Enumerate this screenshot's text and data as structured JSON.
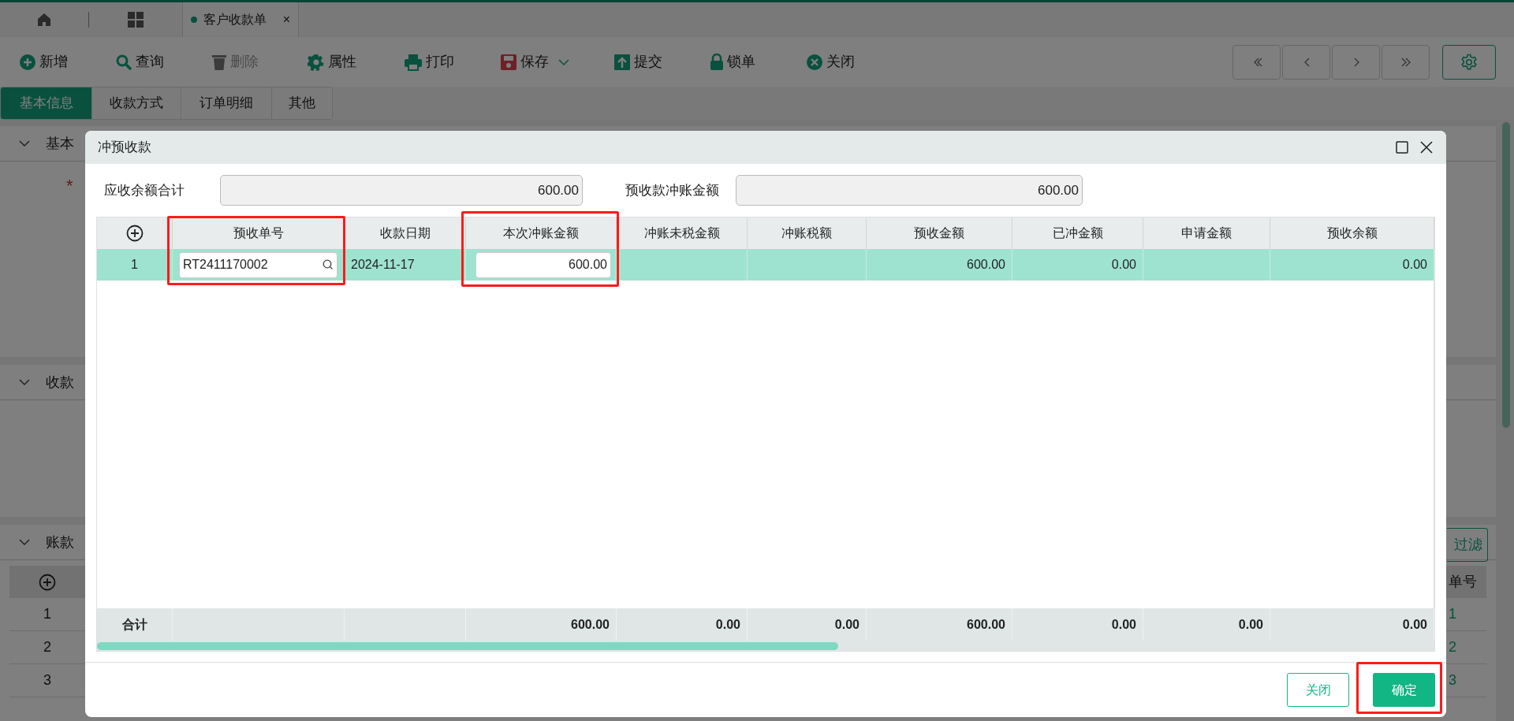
{
  "tab_bar": {
    "tabs": [
      {
        "label": "客户收款单",
        "selected": true,
        "close": "×"
      }
    ]
  },
  "toolbar": {
    "buttons": [
      {
        "label": "新增",
        "kind": "button",
        "disabled": false
      },
      {
        "label": "查询",
        "kind": "button",
        "disabled": false
      },
      {
        "label": "删除",
        "kind": "button",
        "disabled": true
      },
      {
        "label": "属性",
        "kind": "button",
        "disabled": false
      },
      {
        "label": "打印",
        "kind": "button",
        "disabled": false
      },
      {
        "label": "保存",
        "kind": "dropdown",
        "disabled": false
      },
      {
        "label": "提交",
        "kind": "button",
        "disabled": false
      },
      {
        "label": "锁单",
        "kind": "button",
        "disabled": false
      },
      {
        "label": "关闭",
        "kind": "button",
        "disabled": false
      }
    ]
  },
  "page_tabs": [
    {
      "label": "基本信息",
      "selected": true
    },
    {
      "label": "收款方式",
      "selected": false
    },
    {
      "label": "订单明细",
      "selected": false
    },
    {
      "label": "其他",
      "selected": false
    }
  ],
  "background_sections": [
    {
      "title": "基本",
      "required_mark": "*"
    },
    {
      "title": "收款"
    },
    {
      "title": "账款",
      "filter_button": "过滤",
      "table": {
        "column_2": "单号",
        "rows": [
          {
            "row_number": "1",
            "column_2": "1"
          },
          {
            "row_number": "2",
            "column_2": "2"
          },
          {
            "row_number": "3",
            "column_2": "3"
          }
        ]
      }
    }
  ],
  "dialog": {
    "title": "冲预收款",
    "summary": [
      {
        "label": "应收余额合计",
        "value": "600.00"
      },
      {
        "label": "预收款冲账金额",
        "value": "600.00"
      }
    ],
    "table": {
      "columns": [
        "预收单号",
        "收款日期",
        "本次冲账金额",
        "冲账未税金额",
        "冲账税额",
        "预收金额",
        "已冲金额",
        "申请金额",
        "预收余额"
      ],
      "rows": [
        {
          "selected": true,
          "row_number": "1",
          "advance_no": "RT2411170002",
          "date": "2024-11-17",
          "offset_amount": "600.00",
          "advance_amount": "600.00",
          "offset_done": "0.00",
          "balance": "0.00"
        }
      ],
      "totals": {
        "label": "合计",
        "values": [
          "600.00",
          "0.00",
          "0.00",
          "600.00",
          "0.00",
          "0.00",
          "0.00"
        ]
      }
    },
    "buttons": [
      {
        "label": "关闭",
        "kind": "secondary"
      },
      {
        "label": "确定",
        "kind": "primary"
      }
    ]
  }
}
